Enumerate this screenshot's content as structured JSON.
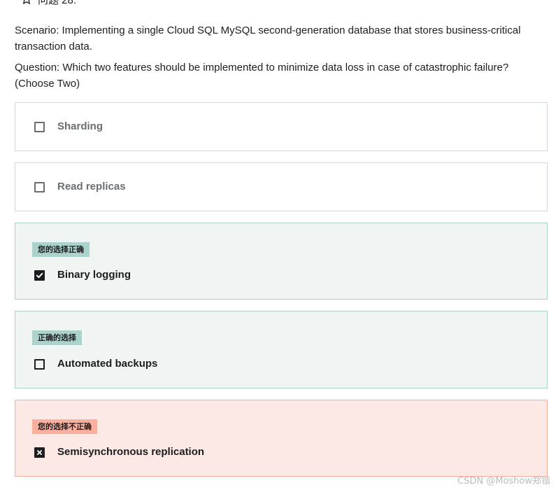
{
  "question": {
    "header": "问题 28:",
    "scenario": "Scenario: Implementing a single Cloud SQL MySQL second-generation database that stores business-critical transaction data.",
    "question": "Question: Which two features should be implemented to minimize data loss in case of catastrophic failure? (Choose Two)"
  },
  "options": [
    {
      "label": "Sharding",
      "checked": false,
      "status": "neutral",
      "badge": ""
    },
    {
      "label": "Read replicas",
      "checked": false,
      "status": "neutral",
      "badge": ""
    },
    {
      "label": "Binary logging",
      "checked": true,
      "status": "correct",
      "badge": "您的选择正确"
    },
    {
      "label": "Automated backups",
      "checked": false,
      "status": "correct",
      "badge": "正确的选择"
    },
    {
      "label": "Semisynchronous replication",
      "checked": true,
      "status": "incorrect",
      "badge": "您的选择不正确"
    }
  ],
  "watermark": "CSDN @Moshow郑锴",
  "icons": {
    "header": "star-outline-icon",
    "checked": "check-icon",
    "wrong": "x-mark-icon"
  },
  "colors": {
    "correct_bg": "#f0f5f3",
    "correct_badge": "#acd2cc",
    "incorrect_bg": "#fce9e6",
    "incorrect_badge": "#fbb09e",
    "text": "#1c1d1f",
    "muted": "#6a6f73"
  }
}
